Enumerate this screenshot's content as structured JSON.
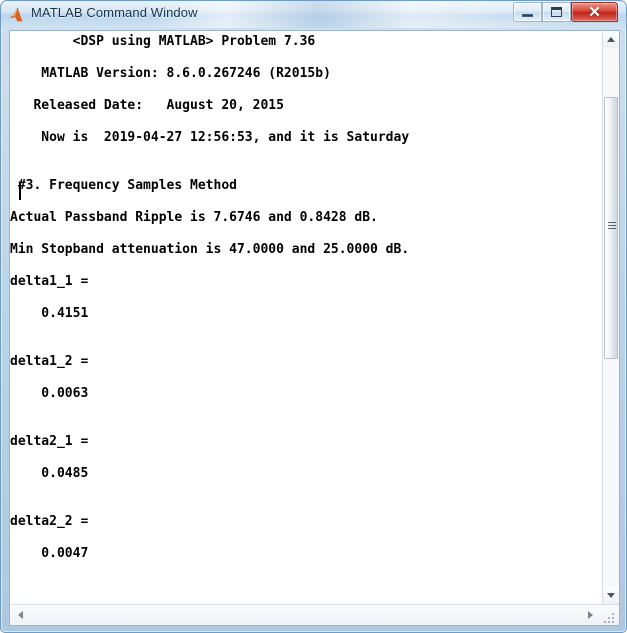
{
  "window": {
    "title": "MATLAB Command Window",
    "app_icon": "matlab-membrane-icon",
    "accent_title_color": "#13344e",
    "close_button_color": "#bc2417"
  },
  "titlebar_buttons": {
    "minimize_label": "–",
    "maximize_label": "□",
    "close_label": "✕"
  },
  "console": {
    "text": "        <DSP using MATLAB> Problem 7.36\n\n    MATLAB Version: 8.6.0.267246 (R2015b)\n\n   Released Date:   August 20, 2015\n\n    Now is  2019-04-27 12:56:53, and it is Saturday\n\n\n #3. Frequency Samples Method\n\nActual Passband Ripple is 7.6746 and 0.8428 dB.\n\nMin Stopband attenuation is 47.0000 and 25.0000 dB.\n\ndelta1_1 =\n\n    0.4151\n\n\ndelta1_2 =\n\n    0.0063\n\n\ndelta2_1 =\n\n    0.0485\n\n\ndelta2_2 =\n\n    0.0047\n",
    "lines": [
      "        <DSP using MATLAB> Problem 7.36",
      "",
      "    MATLAB Version: 8.6.0.267246 (R2015b)",
      "",
      "   Released Date:   August 20, 2015",
      "",
      "    Now is  2019-04-27 12:56:53, and it is Saturday",
      "",
      "",
      " #3. Frequency Samples Method",
      "",
      "Actual Passband Ripple is 7.6746 and 0.8428 dB.",
      "",
      "Min Stopband attenuation is 47.0000 and 25.0000 dB.",
      "",
      "delta1_1 =",
      "",
      "    0.4151",
      "",
      "",
      "delta1_2 =",
      "",
      "    0.0063",
      "",
      "",
      "delta2_1 =",
      "",
      "    0.0485",
      "",
      "",
      "delta2_2 =",
      "",
      "    0.0047"
    ],
    "header": {
      "problem_title": "<DSP using MATLAB> Problem 7.36",
      "matlab_version": "MATLAB Version: 8.6.0.267246 (R2015b)",
      "released_date": "Released Date:   August 20, 2015",
      "now_is": "Now is  2019-04-27 12:56:53, and it is Saturday"
    },
    "section": {
      "heading": "#3. Frequency Samples Method",
      "passband_ripple": "Actual Passband Ripple is 7.6746 and 0.8428 dB.",
      "stopband_attenuation": "Min Stopband attenuation is 47.0000 and 25.0000 dB."
    },
    "variables": [
      {
        "name": "delta1_1 =",
        "value": "    0.4151"
      },
      {
        "name": "delta1_2 =",
        "value": "    0.0063"
      },
      {
        "name": "delta2_1 =",
        "value": "    0.0485"
      },
      {
        "name": "delta2_2 =",
        "value": "    0.0047"
      }
    ]
  },
  "scrollbars": {
    "vertical": {
      "up_arrow": "▲",
      "down_arrow": "▼"
    },
    "horizontal": {
      "left_arrow": "◀",
      "right_arrow": "▶"
    }
  }
}
